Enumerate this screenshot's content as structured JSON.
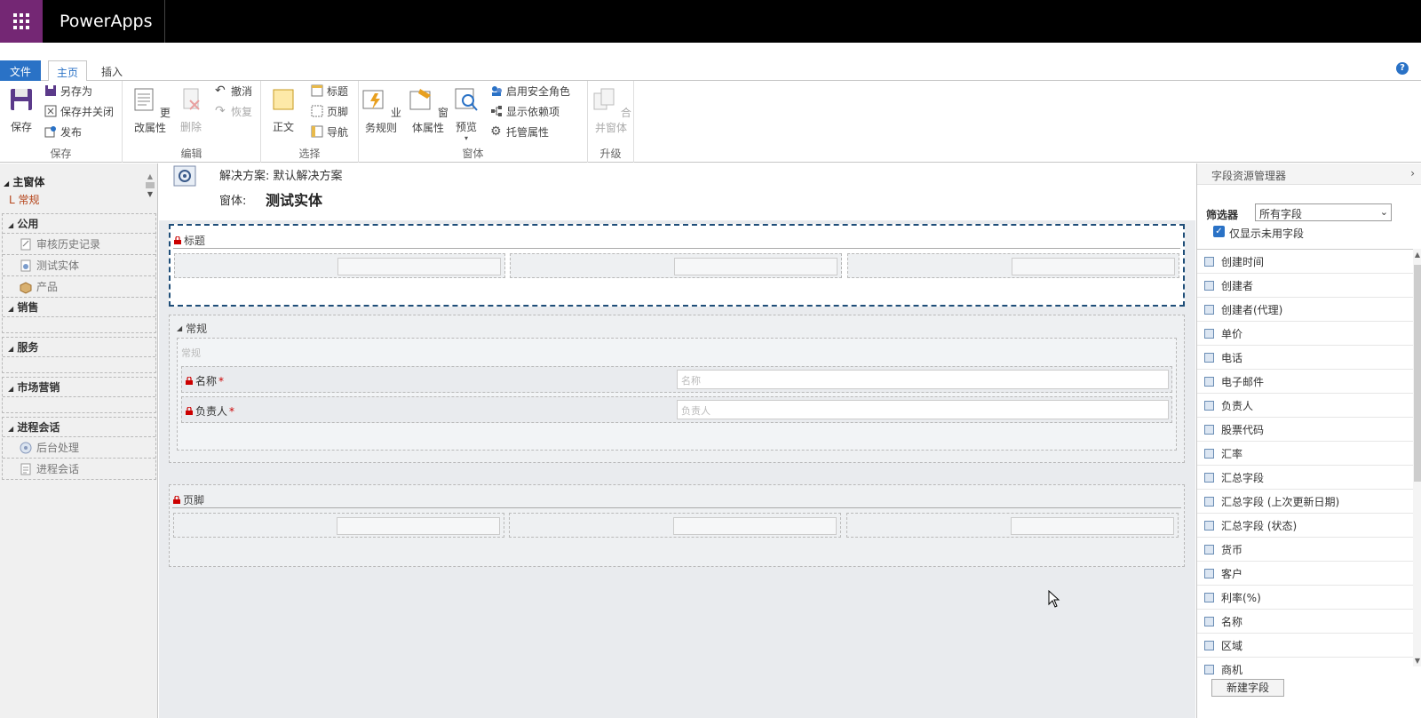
{
  "app": {
    "title": "PowerApps"
  },
  "ribbon_tabs": {
    "file": "文件",
    "home": "主页",
    "insert": "插入",
    "help": "?"
  },
  "ribbon": {
    "save_group": {
      "save": "保存",
      "save_as": "另存为",
      "save_close": "保存并关闭",
      "publish": "发布",
      "label": "保存"
    },
    "edit_group": {
      "change_props": "更改属性",
      "delete": "删除",
      "undo": "撤消",
      "redo": "恢复",
      "label": "编辑"
    },
    "select_group": {
      "body": "正文",
      "header": "标题",
      "footer": "页脚",
      "nav": "导航",
      "label": "选择"
    },
    "form_group": {
      "business_rules": "业务规则",
      "form_props": "窗体属性",
      "preview": "预览",
      "enable_security": "启用安全角色",
      "show_deps": "显示依赖项",
      "managed_props": "托管属性",
      "label": "窗体"
    },
    "upgrade_group": {
      "merge": "合并窗体",
      "label": "升级"
    }
  },
  "left_nav": {
    "main_form": "主窗体",
    "general": "常规",
    "sections": [
      {
        "title": "公用",
        "items": [
          "审核历史记录",
          "测试实体",
          "产品"
        ]
      },
      {
        "title": "销售",
        "items": []
      },
      {
        "title": "服务",
        "items": []
      },
      {
        "title": "市场营销",
        "items": []
      },
      {
        "title": "进程会话",
        "items": [
          "后台处理",
          "进程会话"
        ]
      }
    ]
  },
  "canvas": {
    "solution": "解决方案: 默认解决方案",
    "form_label": "窗体:",
    "form_name": "测试实体",
    "header_title": "标题",
    "general_tab": "常规",
    "general_section": "常规",
    "fields": [
      {
        "label": "名称",
        "required": "*",
        "placeholder": "名称"
      },
      {
        "label": "负责人",
        "required": "*",
        "placeholder": "负责人"
      }
    ],
    "footer_title": "页脚"
  },
  "field_explorer": {
    "title": "字段资源管理器",
    "filter_label": "筛选器",
    "filter_value": "所有字段",
    "only_unused": "仅显示未用字段",
    "fields": [
      "创建时间",
      "创建者",
      "创建者(代理)",
      "单价",
      "电话",
      "电子邮件",
      "负责人",
      "股票代码",
      "汇率",
      "汇总字段",
      "汇总字段 (上次更新日期)",
      "汇总字段 (状态)",
      "货币",
      "客户",
      "利率(%)",
      "名称",
      "区域",
      "商机"
    ],
    "new_field": "新建字段"
  }
}
